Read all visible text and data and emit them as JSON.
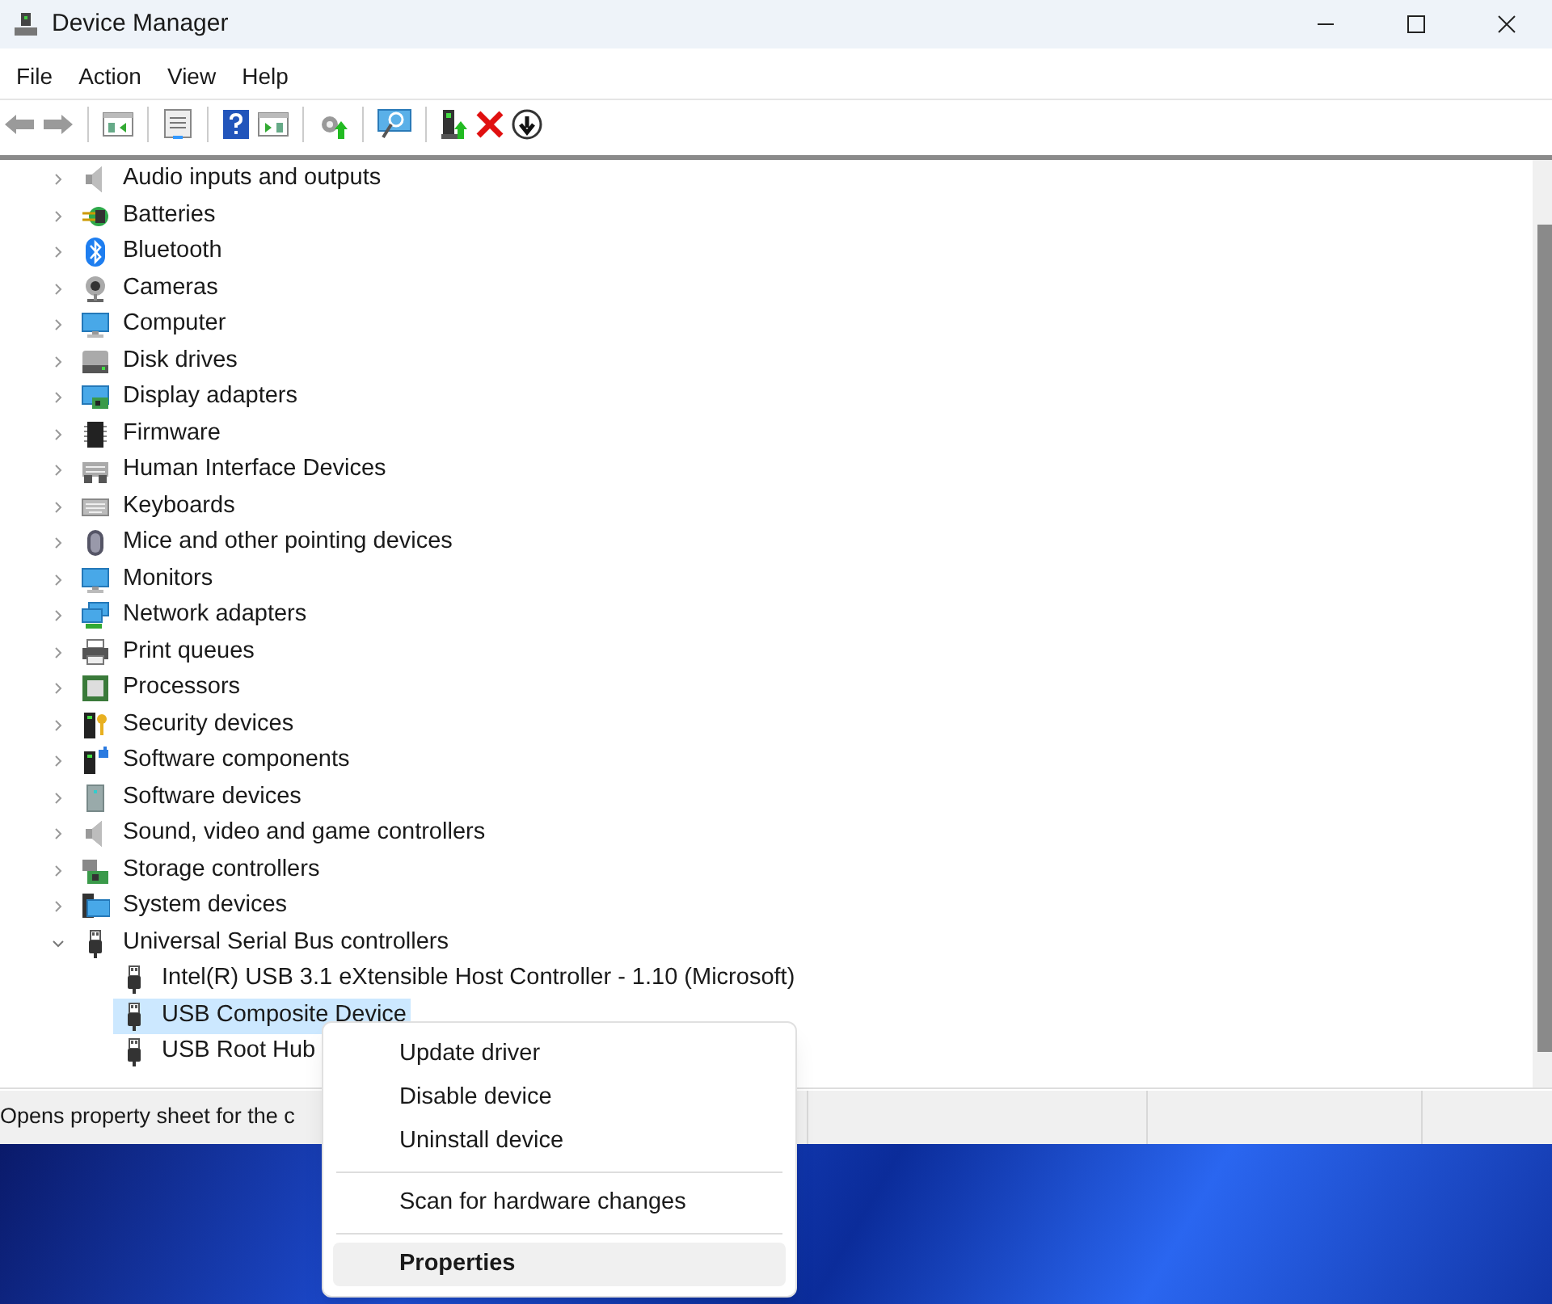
{
  "window": {
    "title": "Device Manager"
  },
  "menu": [
    "File",
    "Action",
    "View",
    "Help"
  ],
  "tree": {
    "items": [
      {
        "label": "Audio inputs and outputs",
        "expanded": false,
        "selected": false
      },
      {
        "label": "Batteries",
        "expanded": false,
        "selected": false
      },
      {
        "label": "Bluetooth",
        "expanded": false,
        "selected": false
      },
      {
        "label": "Cameras",
        "expanded": false,
        "selected": false
      },
      {
        "label": "Computer",
        "expanded": false,
        "selected": false
      },
      {
        "label": "Disk drives",
        "expanded": false,
        "selected": false
      },
      {
        "label": "Display adapters",
        "expanded": false,
        "selected": false
      },
      {
        "label": "Firmware",
        "expanded": false,
        "selected": false
      },
      {
        "label": "Human Interface Devices",
        "expanded": false,
        "selected": false
      },
      {
        "label": "Keyboards",
        "expanded": false,
        "selected": false
      },
      {
        "label": "Mice and other pointing devices",
        "expanded": false,
        "selected": false
      },
      {
        "label": "Monitors",
        "expanded": false,
        "selected": false
      },
      {
        "label": "Network adapters",
        "expanded": false,
        "selected": false
      },
      {
        "label": "Print queues",
        "expanded": false,
        "selected": false
      },
      {
        "label": "Processors",
        "expanded": false,
        "selected": false
      },
      {
        "label": "Security devices",
        "expanded": false,
        "selected": false
      },
      {
        "label": "Software components",
        "expanded": false,
        "selected": false
      },
      {
        "label": "Software devices",
        "expanded": false,
        "selected": false
      },
      {
        "label": "Sound, video and game controllers",
        "expanded": false,
        "selected": false
      },
      {
        "label": "Storage controllers",
        "expanded": false,
        "selected": false
      },
      {
        "label": "System devices",
        "expanded": false,
        "selected": false
      },
      {
        "label": "Universal Serial Bus controllers",
        "expanded": true,
        "selected": false,
        "children": [
          {
            "label": "Intel(R) USB 3.1 eXtensible Host Controller - 1.10 (Microsoft)",
            "selected": false
          },
          {
            "label": "USB Composite Device",
            "selected": true
          },
          {
            "label": "USB Root Hub",
            "selected": false
          }
        ]
      }
    ]
  },
  "status_bar": {
    "text": "Opens property sheet for the c"
  },
  "context_menu": {
    "items": [
      {
        "kind": "item",
        "label": "Update driver",
        "selected": false,
        "default": false
      },
      {
        "kind": "item",
        "label": "Disable device",
        "selected": false,
        "default": false
      },
      {
        "kind": "item",
        "label": "Uninstall device",
        "selected": false,
        "default": false
      },
      {
        "kind": "separator"
      },
      {
        "kind": "item",
        "label": "Scan for hardware changes",
        "selected": false,
        "default": false
      },
      {
        "kind": "separator"
      },
      {
        "kind": "item",
        "label": "Properties",
        "selected": true,
        "default": true
      }
    ]
  }
}
